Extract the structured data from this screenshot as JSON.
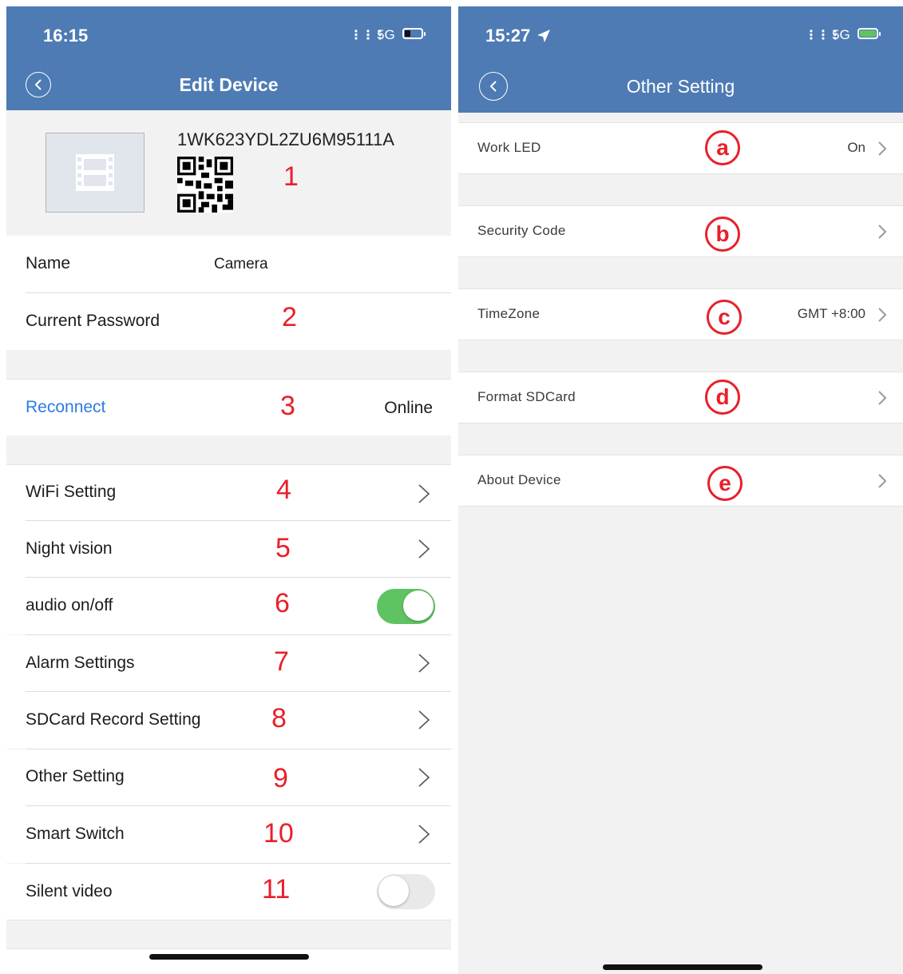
{
  "left": {
    "status": {
      "time": "16:15",
      "network": "5G"
    },
    "title": "Edit Device",
    "device": {
      "id": "1WK623YDL2ZU6M95111A"
    },
    "rows": {
      "name": {
        "label": "Name",
        "value": "Camera"
      },
      "password": {
        "label": "Current Password"
      },
      "reconnect": {
        "label": "Reconnect",
        "status": "Online"
      },
      "wifi": {
        "label": "WiFi Setting"
      },
      "night": {
        "label": "Night vision"
      },
      "audio": {
        "label": "audio on/off",
        "state": "on"
      },
      "alarm": {
        "label": "Alarm Settings"
      },
      "sdcard": {
        "label": "SDCard Record Setting"
      },
      "other": {
        "label": "Other Setting"
      },
      "smart": {
        "label": "Smart Switch"
      },
      "silent": {
        "label": "Silent video",
        "state": "off"
      }
    },
    "annotations": [
      "1",
      "2",
      "3",
      "4",
      "5",
      "6",
      "7",
      "8",
      "9",
      "10",
      "11"
    ]
  },
  "right": {
    "status": {
      "time": "15:27",
      "network": "5G"
    },
    "title": "Other Setting",
    "items": [
      {
        "label": "Work LED",
        "value": "On",
        "badge": "a"
      },
      {
        "label": "Security Code",
        "value": "",
        "badge": "b"
      },
      {
        "label": "TimeZone",
        "value": "GMT +8:00",
        "badge": "c"
      },
      {
        "label": "Format SDCard",
        "value": "",
        "badge": "d"
      },
      {
        "label": "About Device",
        "value": "",
        "badge": "e"
      }
    ]
  },
  "colors": {
    "header": "#4e7bb4",
    "link": "#2f7be0",
    "annotation": "#e8202a",
    "toggle_on": "#5fc362"
  },
  "icons": [
    "back-arrow-icon",
    "chevron-right-icon",
    "film-icon",
    "qr-code-icon",
    "location-arrow-icon",
    "battery-icon",
    "signal-icon"
  ]
}
